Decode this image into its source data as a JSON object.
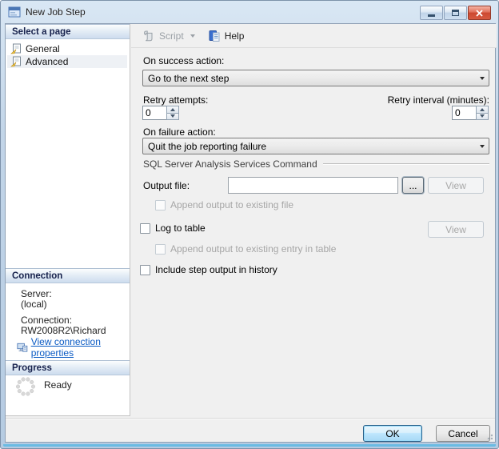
{
  "window": {
    "title": "New Job Step"
  },
  "toolbar": {
    "script_label": "Script",
    "help_label": "Help"
  },
  "sidebar": {
    "select_page": {
      "header": "Select a page",
      "items": [
        {
          "label": "General"
        },
        {
          "label": "Advanced"
        }
      ]
    },
    "connection": {
      "header": "Connection",
      "server_label": "Server:",
      "server_value": "(local)",
      "connection_label": "Connection:",
      "connection_value": "RW2008R2\\Richard",
      "link_label": "View connection properties"
    },
    "progress": {
      "header": "Progress",
      "status": "Ready"
    }
  },
  "main": {
    "on_success": {
      "label": "On success action:",
      "value": "Go to the next step"
    },
    "retry_attempts": {
      "label": "Retry attempts:",
      "value": "0"
    },
    "retry_interval": {
      "label": "Retry interval (minutes):",
      "value": "0"
    },
    "on_failure": {
      "label": "On failure action:",
      "value": "Quit the job reporting failure"
    },
    "group_label": "SQL Server Analysis Services Command",
    "output_file": {
      "label": "Output file:",
      "value": "",
      "browse_label": "...",
      "view_label": "View"
    },
    "append_file": {
      "label": "Append output to existing file"
    },
    "log_table": {
      "label": "Log to table",
      "view_label": "View"
    },
    "append_table": {
      "label": "Append output to existing entry in table"
    },
    "include_history": {
      "label": "Include step output in history"
    }
  },
  "footer": {
    "ok_label": "OK",
    "cancel_label": "Cancel"
  },
  "icons": {
    "app": "form-icon",
    "script": "scroll-icon",
    "help": "help-doc-icon",
    "page": "page-icon",
    "connection": "connection-properties-icon",
    "progress": "progress-spinner-icon"
  },
  "colors": {
    "link": "#0b5bc4",
    "header_text": "#16214c",
    "close_button": "#cc4830",
    "default_button_border": "#2c628b",
    "content_bg": "#f0f0f0"
  }
}
